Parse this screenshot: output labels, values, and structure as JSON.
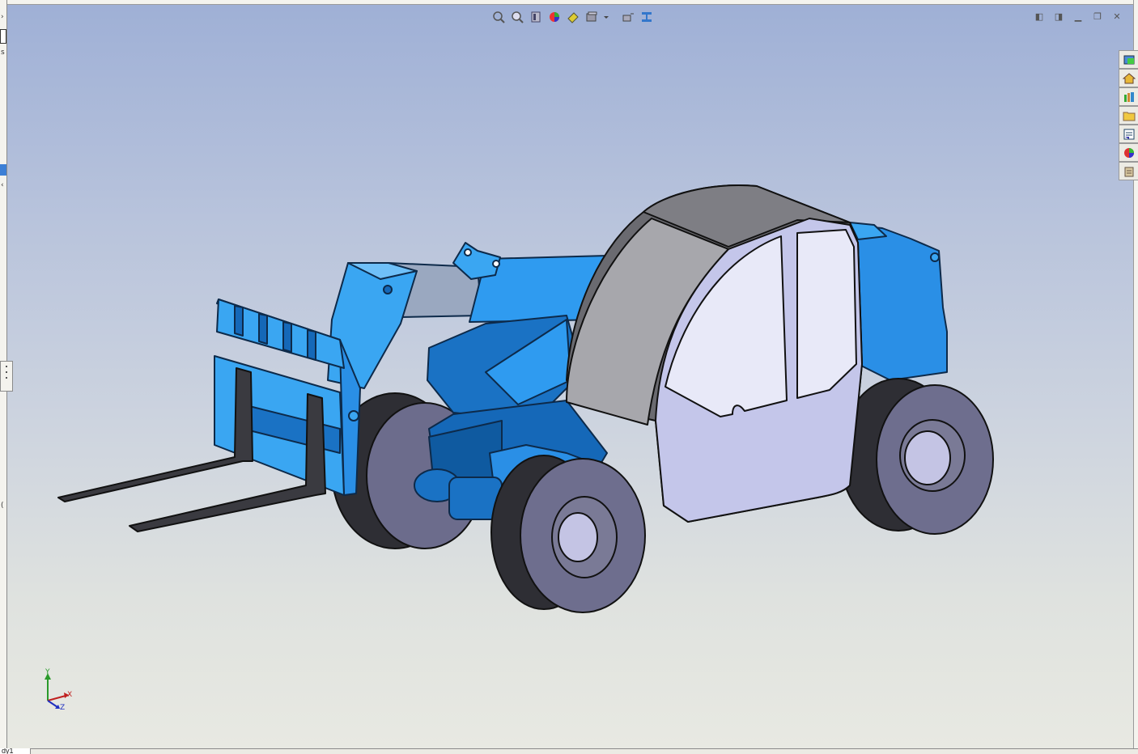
{
  "window": {
    "controls": [
      "restore-left",
      "restore-right",
      "minimize",
      "maximize",
      "close"
    ]
  },
  "heads_up_toolbar": {
    "buttons": [
      {
        "name": "zoom-to-fit",
        "icon": "zoom-fit-icon"
      },
      {
        "name": "zoom-to-area",
        "icon": "zoom-area-icon"
      },
      {
        "name": "previous-view",
        "icon": "previous-view-icon"
      },
      {
        "name": "section-view",
        "icon": "section-view-icon"
      },
      {
        "name": "view-orientation",
        "icon": "view-orientation-icon"
      },
      {
        "name": "display-style",
        "icon": "display-style-icon"
      },
      {
        "name": "hide-show-items",
        "icon": "hide-show-icon"
      },
      {
        "name": "edit-appearance",
        "icon": "appearance-icon"
      },
      {
        "name": "apply-scene",
        "icon": "scene-icon"
      }
    ]
  },
  "task_pane": {
    "tabs": [
      {
        "name": "solidworks-resources",
        "icon": "resources-icon",
        "color": "#3a9a3a"
      },
      {
        "name": "design-library",
        "icon": "home-icon",
        "color": "#d9a520"
      },
      {
        "name": "file-explorer",
        "icon": "library-icon",
        "color": "#2f8a3a"
      },
      {
        "name": "view-palette",
        "icon": "folder-icon",
        "color": "#e8c040"
      },
      {
        "name": "appearances",
        "icon": "palette-list-icon",
        "color": "#3a5ea8"
      },
      {
        "name": "custom-properties",
        "icon": "color-wheel-icon",
        "color": "#c03030"
      },
      {
        "name": "document-recovery",
        "icon": "clipboard-icon",
        "color": "#8a6a3a"
      }
    ]
  },
  "triad": {
    "x_label": "X",
    "y_label": "Y",
    "z_label": "Z"
  },
  "bottom_tab": {
    "label": "dy1"
  },
  "colors": {
    "body_blue": "#2a8fe6",
    "light_blue": "#3aa6f2",
    "dark_blue": "#1568b8",
    "tire": "#3a3a40",
    "rim": "#6e6e8e",
    "cab_panel": "#c4c6ea",
    "cab_roof": "#6a6a70",
    "glass": "#e8e9f8"
  }
}
